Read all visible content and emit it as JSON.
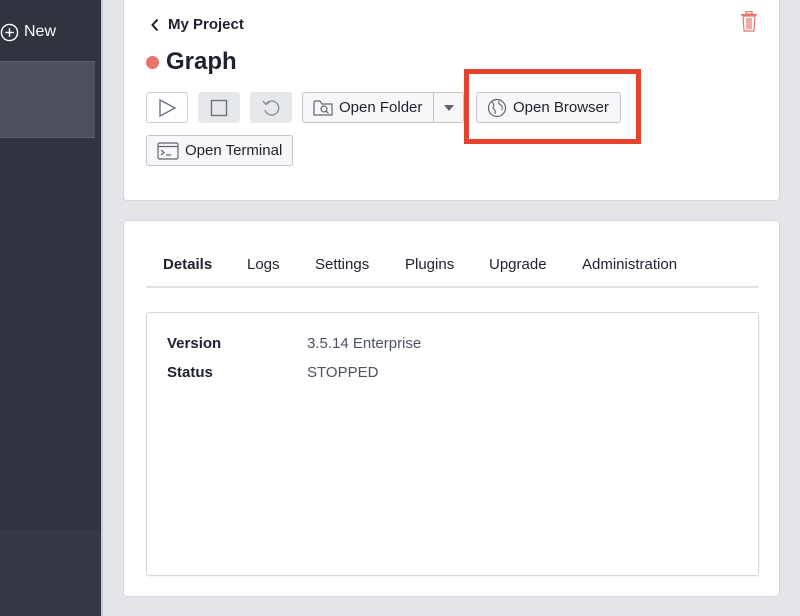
{
  "sidebar": {
    "new_label": "New"
  },
  "project": {
    "back_label": "My Project",
    "title": "Graph",
    "status_color": "#e8756a"
  },
  "toolbar": {
    "open_folder_label": "Open Folder",
    "open_browser_label": "Open Browser",
    "open_terminal_label": "Open Terminal"
  },
  "icons": {
    "play": "play-icon",
    "stop": "stop-icon",
    "restart": "restart-icon",
    "folder": "folder-search-icon",
    "browser": "globe-icon",
    "terminal": "terminal-icon",
    "trash": "trash-icon",
    "back": "chevron-left-icon",
    "new": "plus-circle-icon"
  },
  "tabs": [
    {
      "label": "Details",
      "active": true
    },
    {
      "label": "Logs"
    },
    {
      "label": "Settings"
    },
    {
      "label": "Plugins"
    },
    {
      "label": "Upgrade"
    },
    {
      "label": "Administration"
    }
  ],
  "details": {
    "version_label": "Version",
    "version_value": "3.5.14 Enterprise",
    "status_label": "Status",
    "status_value": "STOPPED"
  },
  "colors": {
    "highlight": "#e3422f",
    "trash": "#e8756a",
    "sidebar_bg": "#2f343f"
  }
}
